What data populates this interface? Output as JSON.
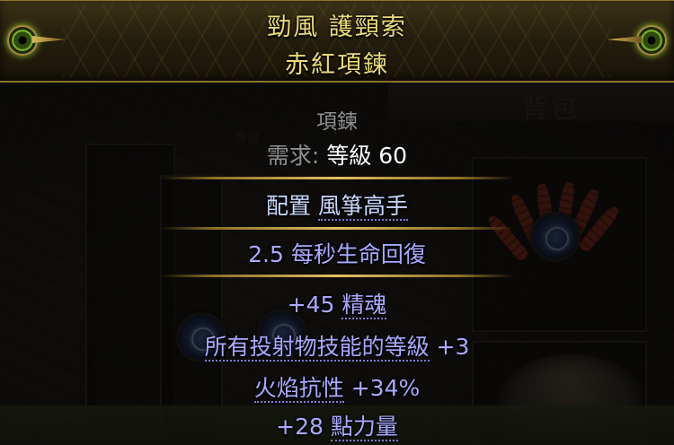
{
  "item": {
    "name": "勁風 護頸索",
    "base_type": "赤紅項鍊",
    "item_class": "項鍊",
    "requirement": {
      "label": "需求:",
      "value": "等級 60"
    },
    "enchant": {
      "prefix": "配置 ",
      "keyword": "風箏高手"
    },
    "implicit": "2.5 每秒生命回復",
    "explicit_mods": [
      {
        "before": "+45 ",
        "keyword": "精魂",
        "after": ""
      },
      {
        "before": "",
        "keyword": "所有投射物技能的等級",
        "after": " +3"
      },
      {
        "before": "",
        "keyword": "火焰抗性",
        "after": " +34%"
      },
      {
        "before": "+28 ",
        "keyword": "點力量",
        "after": ""
      }
    ]
  },
  "inventory": {
    "title": "背包",
    "title_small": "背包"
  },
  "colors": {
    "title_gold": "#e9da7a",
    "mod_blue": "#a9a9ff",
    "label_gray": "#8f8f8f",
    "separator_gold": "#e2c063"
  }
}
